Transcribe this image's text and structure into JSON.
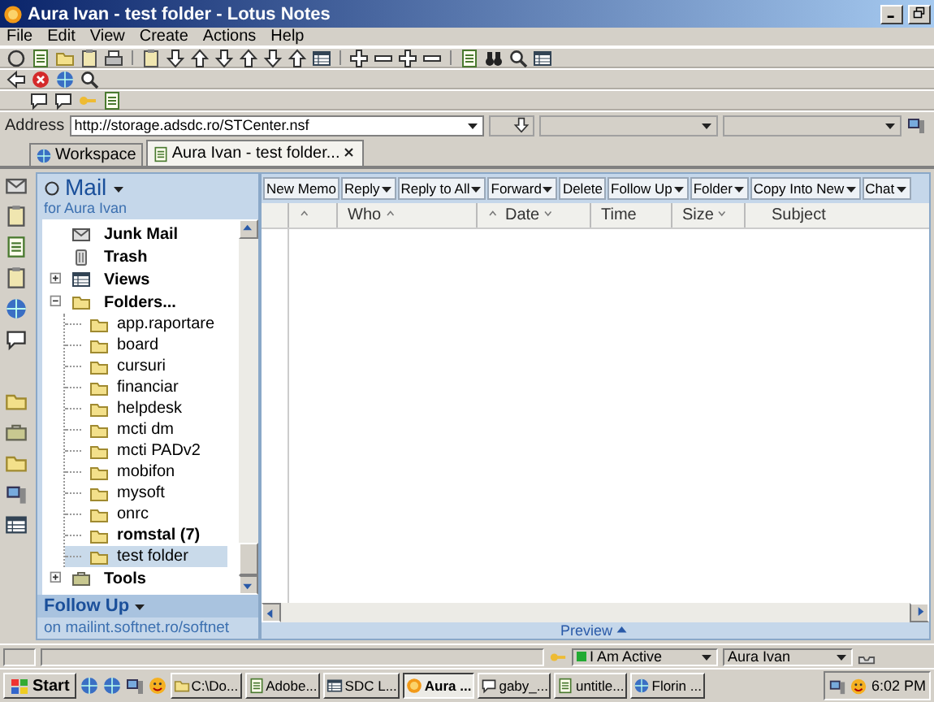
{
  "window": {
    "title": "Aura Ivan - test folder - Lotus Notes"
  },
  "menu": [
    "File",
    "Edit",
    "View",
    "Create",
    "Actions",
    "Help"
  ],
  "address": {
    "label": "Address",
    "value": "http://storage.adsdc.ro/STCenter.nsf"
  },
  "tabs": [
    {
      "label": "Workspace",
      "selected": false,
      "closable": false
    },
    {
      "label": "Aura Ivan - test folder...",
      "selected": true,
      "closable": true
    }
  ],
  "navigator": {
    "title": "Mail",
    "subtitle": "for Aura Ivan",
    "items": [
      {
        "label": "Junk Mail",
        "kind": "junk",
        "selected": false
      },
      {
        "label": "Trash",
        "kind": "trash",
        "selected": false
      },
      {
        "label": "Views",
        "kind": "views",
        "expanded": false,
        "selected": false
      },
      {
        "label": "Folders...",
        "kind": "folders",
        "expanded": true,
        "selected": false,
        "children": [
          {
            "label": "app.raportare",
            "unread": false,
            "selected": false
          },
          {
            "label": "board",
            "unread": false,
            "selected": false
          },
          {
            "label": "cursuri",
            "unread": false,
            "selected": false
          },
          {
            "label": "financiar",
            "unread": false,
            "selected": false
          },
          {
            "label": "helpdesk",
            "unread": false,
            "selected": false
          },
          {
            "label": "mcti dm",
            "unread": false,
            "selected": false
          },
          {
            "label": "mcti PADv2",
            "unread": false,
            "selected": false
          },
          {
            "label": "mobifon",
            "unread": false,
            "selected": false
          },
          {
            "label": "mysoft",
            "unread": false,
            "selected": false
          },
          {
            "label": "onrc",
            "unread": false,
            "selected": false
          },
          {
            "label": "romstal (7)",
            "unread": true,
            "selected": false
          },
          {
            "label": "test folder",
            "unread": false,
            "selected": true
          }
        ]
      },
      {
        "label": "Tools",
        "kind": "tools",
        "expanded": false,
        "selected": false
      }
    ],
    "footer_title": "Follow Up",
    "footer_text": "on mailint.softnet.ro/softnet"
  },
  "actions": [
    {
      "label": "New Memo",
      "dropdown": false
    },
    {
      "label": "Reply",
      "dropdown": true
    },
    {
      "label": "Reply to All",
      "dropdown": true
    },
    {
      "label": "Forward",
      "dropdown": true
    },
    {
      "label": "Delete",
      "dropdown": false
    },
    {
      "label": "Follow Up",
      "dropdown": true
    },
    {
      "label": "Folder",
      "dropdown": true
    },
    {
      "label": "Copy Into New",
      "dropdown": true
    },
    {
      "label": "Chat",
      "dropdown": true
    }
  ],
  "columns": [
    {
      "sorted_ascending": true,
      "sorted_descending": false,
      "resort": false
    },
    {
      "label": "Who",
      "sorted_ascending": true,
      "sorted_descending": false,
      "resort": false
    },
    {
      "label": "Date",
      "sorted_ascending": false,
      "sorted_descending": true,
      "resort": true
    },
    {
      "label": "Time",
      "sorted_ascending": false,
      "sorted_descending": false,
      "resort": false
    },
    {
      "label": "Size",
      "sorted_ascending": false,
      "sorted_descending": true,
      "resort": false
    },
    {
      "label": "Subject",
      "sorted_ascending": false,
      "sorted_descending": false,
      "resort": false
    }
  ],
  "preview": {
    "label": "Preview"
  },
  "status": {
    "presence": "I Am Active",
    "user": "Aura Ivan"
  },
  "taskbar": {
    "start": "Start",
    "clock": "6:02 PM",
    "tasks": [
      {
        "label": "C:\\Do...",
        "selected": false
      },
      {
        "label": "Adobe...",
        "selected": false
      },
      {
        "label": "SDC L...",
        "selected": false
      },
      {
        "label": "Aura ...",
        "selected": true
      },
      {
        "label": "gaby_...",
        "selected": false
      },
      {
        "label": "untitle...",
        "selected": false
      },
      {
        "label": "Florin ...",
        "selected": false
      }
    ]
  }
}
